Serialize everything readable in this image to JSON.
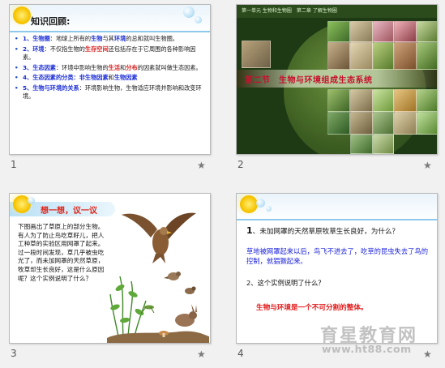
{
  "slides": [
    {
      "number": "1",
      "title": "知识回顾:",
      "bullets": [
        {
          "segments": [
            [
              "k",
              "1、生物圈"
            ],
            [
              "",
              "：地球上所有的"
            ],
            [
              "k",
              "生物"
            ],
            [
              "",
              "与其"
            ],
            [
              "k",
              "环境"
            ],
            [
              "",
              "的总和就叫生物圈。"
            ]
          ]
        },
        {
          "segments": [
            [
              "k",
              "2、环境"
            ],
            [
              "",
              "：不仅指生物的"
            ],
            [
              "r",
              "生存空间"
            ],
            [
              "",
              "还包括存在于它周围的各种影响因素。"
            ]
          ]
        },
        {
          "segments": [
            [
              "k",
              "3、生态因素"
            ],
            [
              "",
              "：环境中影响生物的"
            ],
            [
              "r",
              "生活"
            ],
            [
              "",
              "和"
            ],
            [
              "r",
              "分布"
            ],
            [
              "",
              "的因素就叫做生态因素。"
            ]
          ]
        },
        {
          "segments": [
            [
              "k",
              "4、生态因素的分类：非生物因素"
            ],
            [
              "",
              "和"
            ],
            [
              "k",
              "生物因素"
            ]
          ]
        },
        {
          "segments": [
            [
              "k",
              "5、生物与环境的关系"
            ],
            [
              "",
              "：环境影响生物，生物适应环境并影响和改变环境。"
            ]
          ]
        }
      ]
    },
    {
      "number": "2",
      "header_text": "第一单元 生物和生物圈　第二章 了解生物圈",
      "banner_title": "第二节　生物与环境组成生态系统"
    },
    {
      "number": "3",
      "title": "想一想，议一议",
      "body": "下图画出了草原上的部分生物。　有人为了防止鸟吃草籽儿，把人工种草的实验区用网罩了起来。过一段时间发现，草几乎被虫吃光了，而未加网罩的天然草原，牧草却生长良好，这是什么原因呢？这个实例说明了什么？"
    },
    {
      "number": "4",
      "q1_num": "1",
      "q1_text": "、未加网罩的天然草原牧草生长良好，为什么？",
      "a1": "草地被网罩起来以后，鸟飞不进去了，吃草的昆虫失去了鸟的控制，就猖獗起来。",
      "q2": "2、这个实例说明了什么？",
      "a2": "生物与环境是一个不可分割的整体。"
    }
  ],
  "star_icon": "★",
  "watermark": {
    "name": "育星教育网",
    "url": "www.ht88.com"
  },
  "colors": {
    "keyword_blue": "#1d2fd6",
    "keyword_red": "#d91a1a",
    "slide2_bg": "#1d3a14",
    "banner_red": "#c8102e"
  }
}
